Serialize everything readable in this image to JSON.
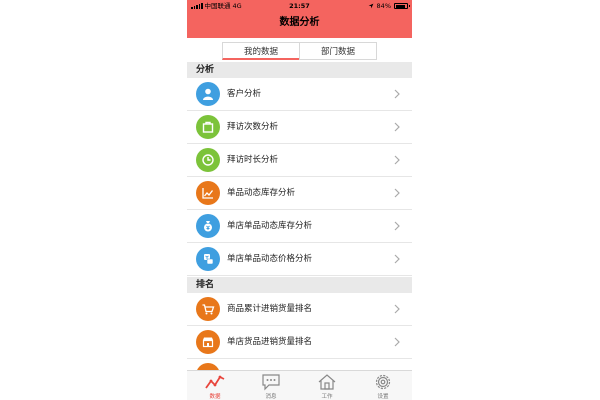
{
  "status_bar": {
    "carrier": "中国联通",
    "network": "4G",
    "time": "21:57",
    "battery": "84%",
    "battery_level": 0.84
  },
  "header": {
    "title": "数据分析"
  },
  "tabs": [
    {
      "label": "我的数据",
      "active": true
    },
    {
      "label": "部门数据",
      "active": false
    }
  ],
  "sections": [
    {
      "title": "分析",
      "items": [
        {
          "label": "客户分析",
          "icon": "user-icon",
          "color": "#3f9fe0"
        },
        {
          "label": "拜访次数分析",
          "icon": "bag-icon",
          "color": "#7cc33a"
        },
        {
          "label": "拜访时长分析",
          "icon": "clock-icon",
          "color": "#7cc33a"
        },
        {
          "label": "单品动态库存分析",
          "icon": "trend-icon",
          "color": "#e8771a"
        },
        {
          "label": "单店单品动态库存分析",
          "icon": "money-bag-icon",
          "color": "#3f9fe0"
        },
        {
          "label": "单店单品动态价格分析",
          "icon": "price-icon",
          "color": "#3f9fe0"
        }
      ]
    },
    {
      "title": "排名",
      "items": [
        {
          "label": "商品累计进销货量排名",
          "icon": "cart-icon",
          "color": "#e8771a"
        },
        {
          "label": "单店货品进销货量排名",
          "icon": "store-icon",
          "color": "#e8771a"
        }
      ]
    }
  ],
  "tabbar": [
    {
      "label": "数据",
      "icon": "chart-line-icon",
      "active": true
    },
    {
      "label": "消息",
      "icon": "chat-icon",
      "active": false
    },
    {
      "label": "工作",
      "icon": "home-icon",
      "active": false
    },
    {
      "label": "设置",
      "icon": "gear-icon",
      "active": false
    }
  ],
  "colors": {
    "header": "#f4645f",
    "active_tab": "#e8453c"
  }
}
